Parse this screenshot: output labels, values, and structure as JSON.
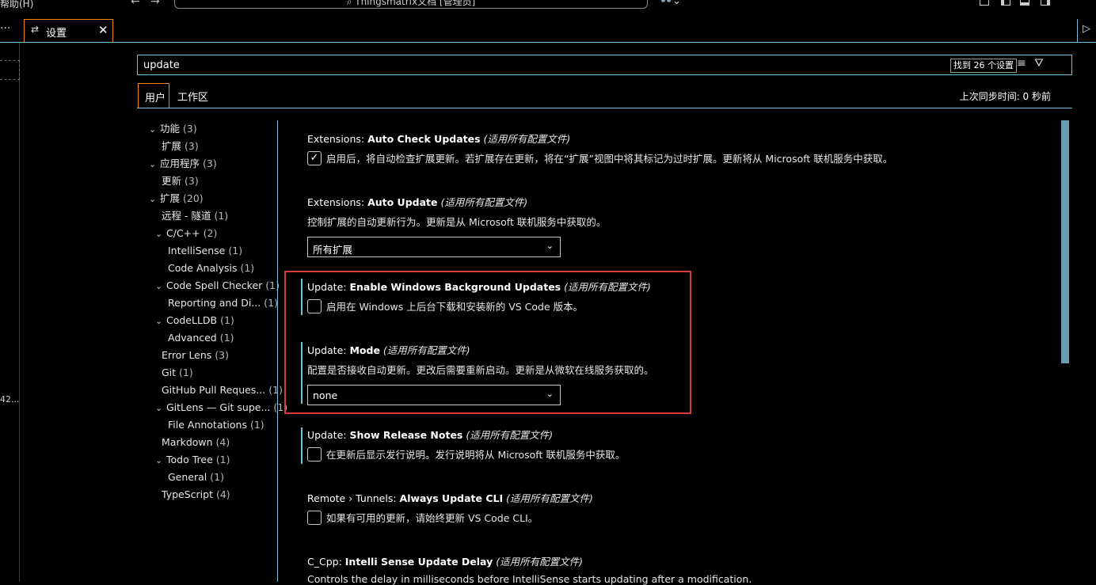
{
  "titlebar": {
    "menu_label": "帮助(H)",
    "back_icon": "←",
    "forward_icon": "→",
    "command_center": "⌕ Thingsmatrix文档 [管理员]",
    "copilot_icon": "👓⌄"
  },
  "tabbar": {
    "more_icon": "···",
    "tab": {
      "icon": "⇄",
      "label": "设置",
      "close": "✕"
    },
    "run_icon": "▷"
  },
  "leftstrip": {
    "truncated_text": "42..."
  },
  "search": {
    "value": "update",
    "result_count": "找到 26 个设置",
    "clear_filter_icon": "≡",
    "filter_icon": "⛛"
  },
  "scope_tabs": {
    "user": "用户",
    "workspace": "工作区"
  },
  "sync_status": "上次同步时间: 0 秒前",
  "toc": [
    {
      "label": "功能",
      "count": "(3)",
      "level": 0,
      "chev": "⌄"
    },
    {
      "label": "扩展",
      "count": "(3)",
      "level": 1,
      "chev": ""
    },
    {
      "label": "应用程序",
      "count": "(3)",
      "level": 0,
      "chev": "⌄"
    },
    {
      "label": "更新",
      "count": "(3)",
      "level": 1,
      "chev": ""
    },
    {
      "label": "扩展",
      "count": "(20)",
      "level": 0,
      "chev": "⌄"
    },
    {
      "label": "远程 - 隧道",
      "count": "(1)",
      "level": 1,
      "chev": ""
    },
    {
      "label": "C/C++",
      "count": "(2)",
      "level": 1,
      "chev": "⌄"
    },
    {
      "label": "IntelliSense",
      "count": "(1)",
      "level": 2,
      "chev": ""
    },
    {
      "label": "Code Analysis",
      "count": "(1)",
      "level": 2,
      "chev": ""
    },
    {
      "label": "Code Spell Checker",
      "count": "(1)",
      "level": 1,
      "chev": "⌄"
    },
    {
      "label": "Reporting and Di...",
      "count": "(1)",
      "level": 2,
      "chev": ""
    },
    {
      "label": "CodeLLDB",
      "count": "(1)",
      "level": 1,
      "chev": "⌄"
    },
    {
      "label": "Advanced",
      "count": "(1)",
      "level": 2,
      "chev": ""
    },
    {
      "label": "Error Lens",
      "count": "(3)",
      "level": 1,
      "chev": ""
    },
    {
      "label": "Git",
      "count": "(1)",
      "level": 1,
      "chev": ""
    },
    {
      "label": "GitHub Pull Reques...",
      "count": "(1)",
      "level": 1,
      "chev": ""
    },
    {
      "label": "GitLens — Git supe...",
      "count": "(1)",
      "level": 1,
      "chev": "⌄"
    },
    {
      "label": "File Annotations",
      "count": "(1)",
      "level": 2,
      "chev": ""
    },
    {
      "label": "Markdown",
      "count": "(4)",
      "level": 1,
      "chev": ""
    },
    {
      "label": "Todo Tree",
      "count": "(1)",
      "level": 1,
      "chev": "⌄"
    },
    {
      "label": "General",
      "count": "(1)",
      "level": 2,
      "chev": ""
    },
    {
      "label": "TypeScript",
      "count": "(4)",
      "level": 1,
      "chev": ""
    }
  ],
  "settings": {
    "auto_check": {
      "category": "Extensions: ",
      "name": "Auto Check Updates",
      "scope": "(适用所有配置文件)",
      "checked": true,
      "check_mark": "✓",
      "description": "启用后，将自动检查扩展更新。若扩展存在更新，将在“扩展”视图中将其标记为过时扩展。更新将从 Microsoft 联机服务中获取。"
    },
    "auto_update": {
      "category": "Extensions: ",
      "name": "Auto Update",
      "scope": "(适用所有配置文件)",
      "description": "控制扩展的自动更新行为。更新是从 Microsoft 联机服务中获取的。",
      "value": "所有扩展",
      "arrow": "⌄"
    },
    "bg_updates": {
      "category": "Update: ",
      "name": "Enable Windows Background Updates",
      "scope": "(适用所有配置文件)",
      "checked": false,
      "description": "启用在 Windows 上后台下载和安装新的 VS Code 版本。"
    },
    "mode": {
      "category": "Update: ",
      "name": "Mode",
      "scope": "(适用所有配置文件)",
      "description": "配置是否接收自动更新。更改后需要重新启动。更新是从微软在线服务获取的。",
      "value": "none",
      "arrow": "⌄"
    },
    "release_notes": {
      "category": "Update: ",
      "name": "Show Release Notes",
      "scope": "(适用所有配置文件)",
      "checked": false,
      "description": "在更新后显示发行说明。发行说明将从 Microsoft 联机服务中获取。"
    },
    "tunnels": {
      "category": "Remote › Tunnels: ",
      "name": "Always Update CLI",
      "scope": "(适用所有配置文件)",
      "checked": false,
      "description": "如果有可用的更新，请始终更新 VS Code CLI。"
    },
    "cpp_delay": {
      "category": "C_Cpp: ",
      "name": "Intelli Sense Update Delay",
      "scope": "(适用所有配置文件)",
      "description": "Controls the delay in milliseconds before IntelliSense starts updating after a modification."
    }
  },
  "colors": {
    "focus_border": "#6fc3df",
    "active_border": "#f38518",
    "highlight_box": "#d9393b"
  }
}
